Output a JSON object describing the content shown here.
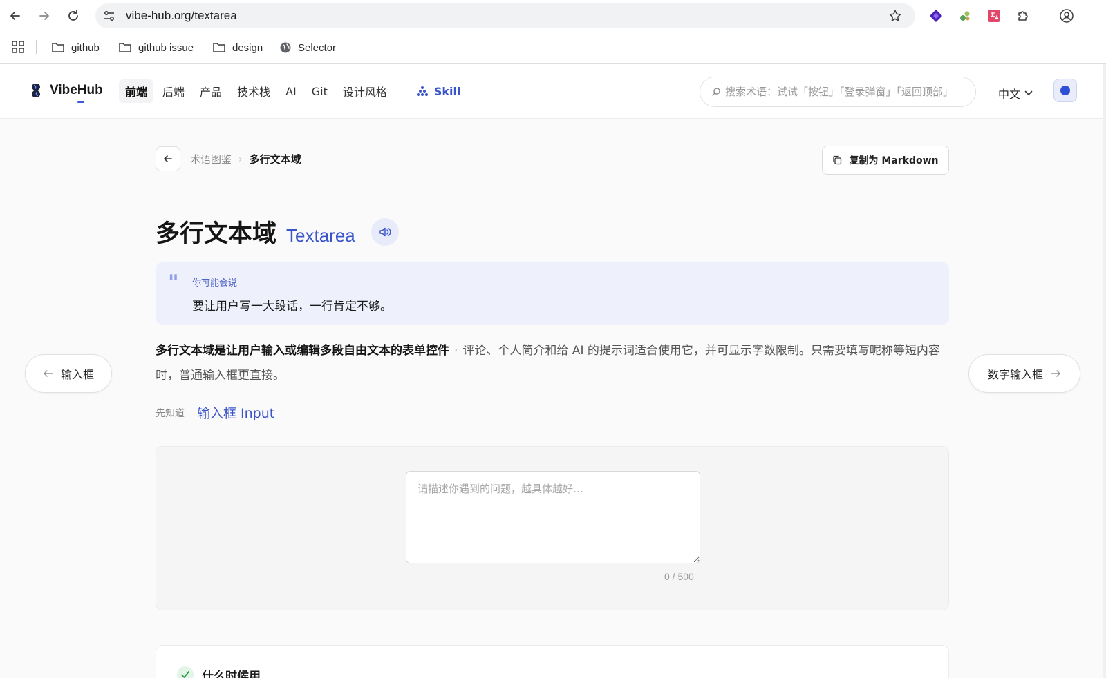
{
  "browser": {
    "url": "vibe-hub.org/textarea",
    "bookmarks": [
      {
        "label": "github",
        "icon": "folder-icon"
      },
      {
        "label": "github issue",
        "icon": "folder-icon"
      },
      {
        "label": "design",
        "icon": "folder-icon"
      },
      {
        "label": "Selector",
        "icon": "globe-icon"
      }
    ]
  },
  "header": {
    "logo_text": "VibeHub",
    "nav": [
      "前端",
      "后端",
      "产品",
      "技术栈",
      "AI",
      "Git",
      "设计风格"
    ],
    "active_nav": "前端",
    "skill_label": "Skill",
    "search_placeholder": "搜索术语：试试「按钮」「登录弹窗」「返回顶部」",
    "language": "中文",
    "accent_color": "#3a55c9"
  },
  "breadcrumb": {
    "parent": "术语图鉴",
    "current": "多行文本域"
  },
  "copy_markdown_label": "复制为 Markdown",
  "term": {
    "title_zh": "多行文本域",
    "title_en": "Textarea"
  },
  "quote": {
    "label": "你可能会说",
    "text": "要让用户写一大段话，一行肯定不够。"
  },
  "description": {
    "lead": "多行文本域是让用户输入或编辑多段自由文本的表单控件",
    "rest": "评论、个人简介和给 AI 的提示词适合使用它，并可显示字数限制。只需要填写昵称等短内容时，普通输入框更直接。"
  },
  "prev_term": "输入框",
  "next_term": "数字输入框",
  "prerequisite": {
    "label": "先知道",
    "link": "输入框 Input"
  },
  "demo": {
    "placeholder": "请描述你遇到的问题，越具体越好…",
    "value": "",
    "counter": "0 / 500"
  },
  "when_to_use": {
    "title": "什么时候用"
  }
}
